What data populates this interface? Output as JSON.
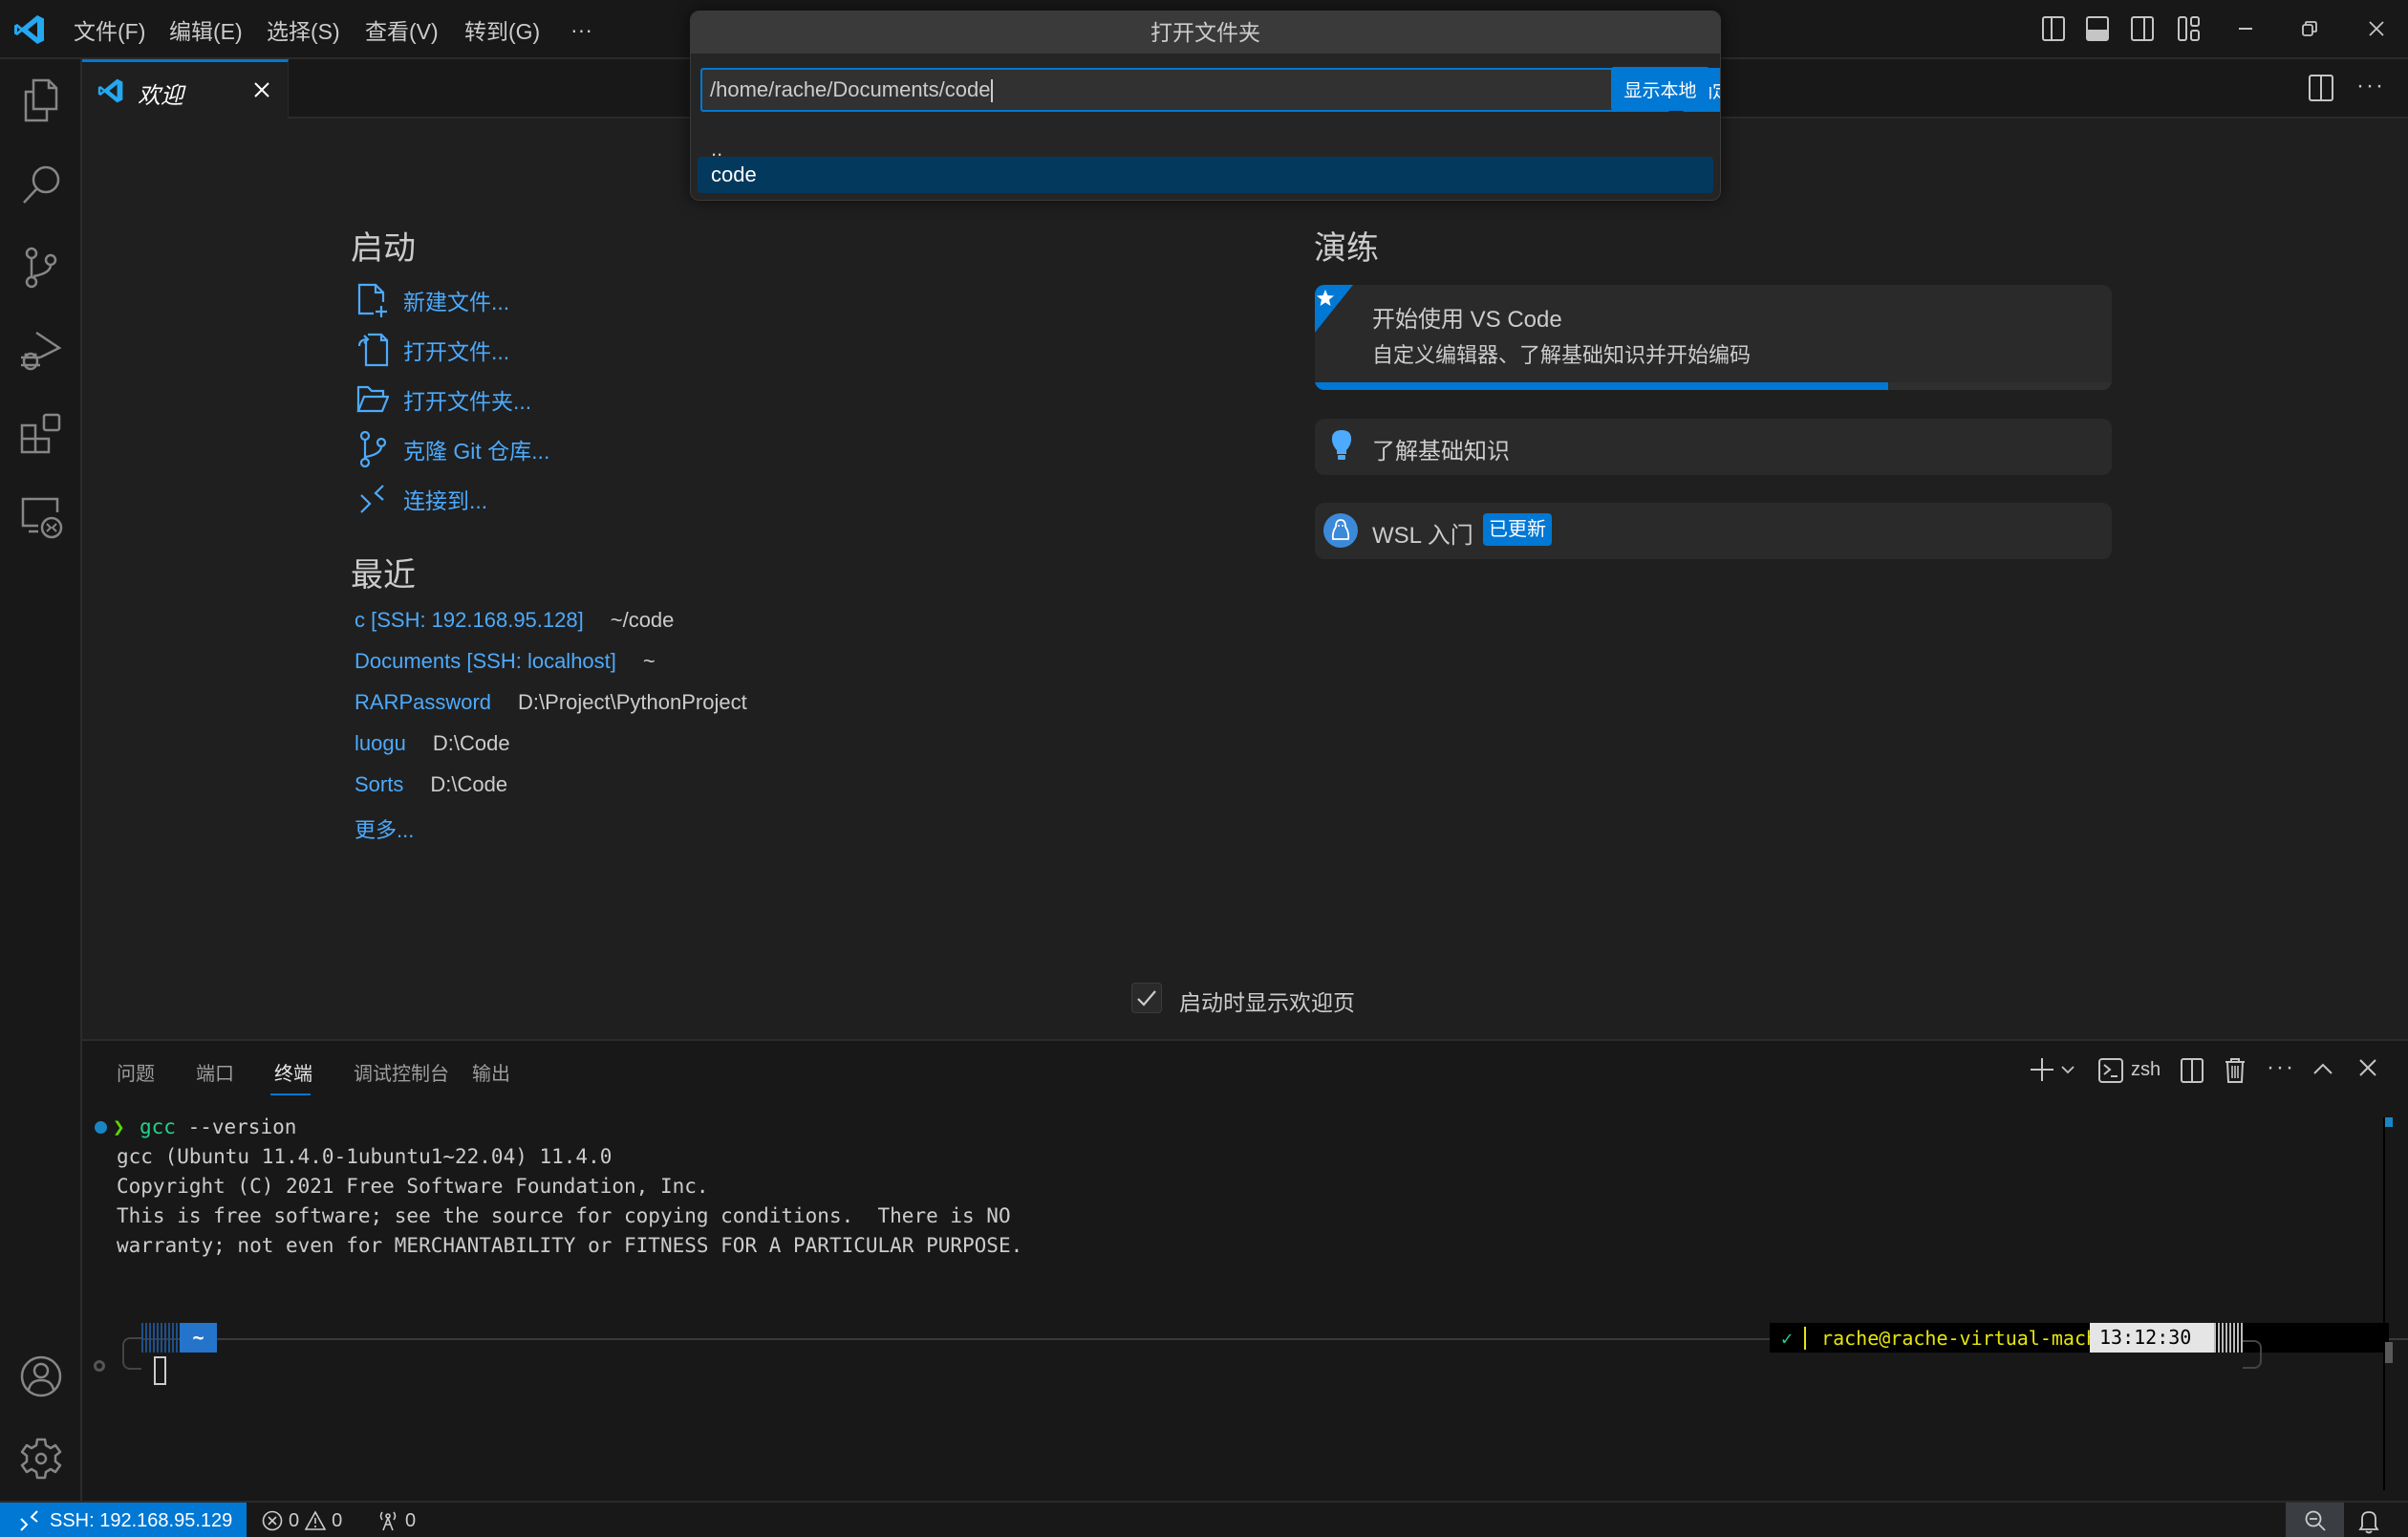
{
  "titlebar": {
    "menus": [
      "文件(F)",
      "编辑(E)",
      "选择(S)",
      "查看(V)",
      "转到(G)",
      "···"
    ],
    "window_controls": [
      "toggle-primary-sidebar",
      "toggle-panel",
      "toggle-secondary-sidebar",
      "customize-layout",
      "minimize",
      "restore",
      "close"
    ]
  },
  "activity_bar": {
    "items": [
      "explorer-icon",
      "search-icon",
      "source-control-icon",
      "run-debug-icon",
      "extensions-icon",
      "remote-explorer-icon"
    ],
    "bottom": [
      "accounts-icon",
      "manage-gear-icon"
    ]
  },
  "tabs": [
    {
      "label": "欢迎",
      "active": true
    }
  ],
  "quick_input": {
    "title": "打开文件夹",
    "value": "/home/rache/Documents/code",
    "ok_label": "确定",
    "show_local_label": "显示本地",
    "items": [
      {
        "label": "..",
        "selected": false
      },
      {
        "label": "code",
        "selected": true
      }
    ]
  },
  "welcome": {
    "start": {
      "heading": "启动",
      "items": [
        {
          "label": "新建文件...",
          "icon": "new-file-icon"
        },
        {
          "label": "打开文件...",
          "icon": "open-file-icon"
        },
        {
          "label": "打开文件夹...",
          "icon": "open-folder-icon"
        },
        {
          "label": "克隆 Git 仓库...",
          "icon": "git-clone-icon"
        },
        {
          "label": "连接到...",
          "icon": "remote-connect-icon"
        }
      ]
    },
    "recent": {
      "heading": "最近",
      "items": [
        {
          "name": "c [SSH: 192.168.95.128]",
          "path": "~/code"
        },
        {
          "name": "Documents [SSH: localhost]",
          "path": "~"
        },
        {
          "name": "RARPassword",
          "path": "D:\\Project\\PythonProject"
        },
        {
          "name": "luogu",
          "path": "D:\\Code"
        },
        {
          "name": "Sorts",
          "path": "D:\\Code"
        }
      ],
      "more_label": "更多..."
    },
    "walkthroughs": {
      "heading": "演练",
      "featured": {
        "title": "开始使用 VS Code",
        "description": "自定义编辑器、了解基础知识并开始编码",
        "progress_percent": 72
      },
      "items": [
        {
          "title": "了解基础知识",
          "icon": "lightbulb-icon"
        },
        {
          "title": "WSL 入门",
          "icon": "linux-penguin-icon",
          "badge": "已更新"
        }
      ]
    },
    "show_on_startup": {
      "label": "启动时显示欢迎页",
      "checked": true
    }
  },
  "panel": {
    "tabs": [
      "问题",
      "端口",
      "终端",
      "调试控制台",
      "输出"
    ],
    "active_tab": "终端",
    "shell_label": "zsh",
    "terminal": {
      "command_name": "gcc",
      "command_args": " --version",
      "output": [
        "gcc (Ubuntu 11.4.0-1ubuntu1~22.04) 11.4.0",
        "Copyright (C) 2021 Free Software Foundation, Inc.",
        "This is free software; see the source for copying conditions.  There is NO",
        "warranty; not even for MERCHANTABILITY or FITNESS FOR A PARTICULAR PURPOSE."
      ],
      "prompt_dir": "~",
      "prompt_status": "✓",
      "prompt_user_host": "rache@rache-virtual-machine",
      "prompt_time": "13:12:30"
    }
  },
  "statusbar": {
    "remote": "SSH: 192.168.95.129",
    "errors": "0",
    "warnings": "0",
    "ports": "0"
  },
  "colors": {
    "accent": "#0078d4",
    "link": "#4daafc",
    "selected_row": "#04395e"
  }
}
